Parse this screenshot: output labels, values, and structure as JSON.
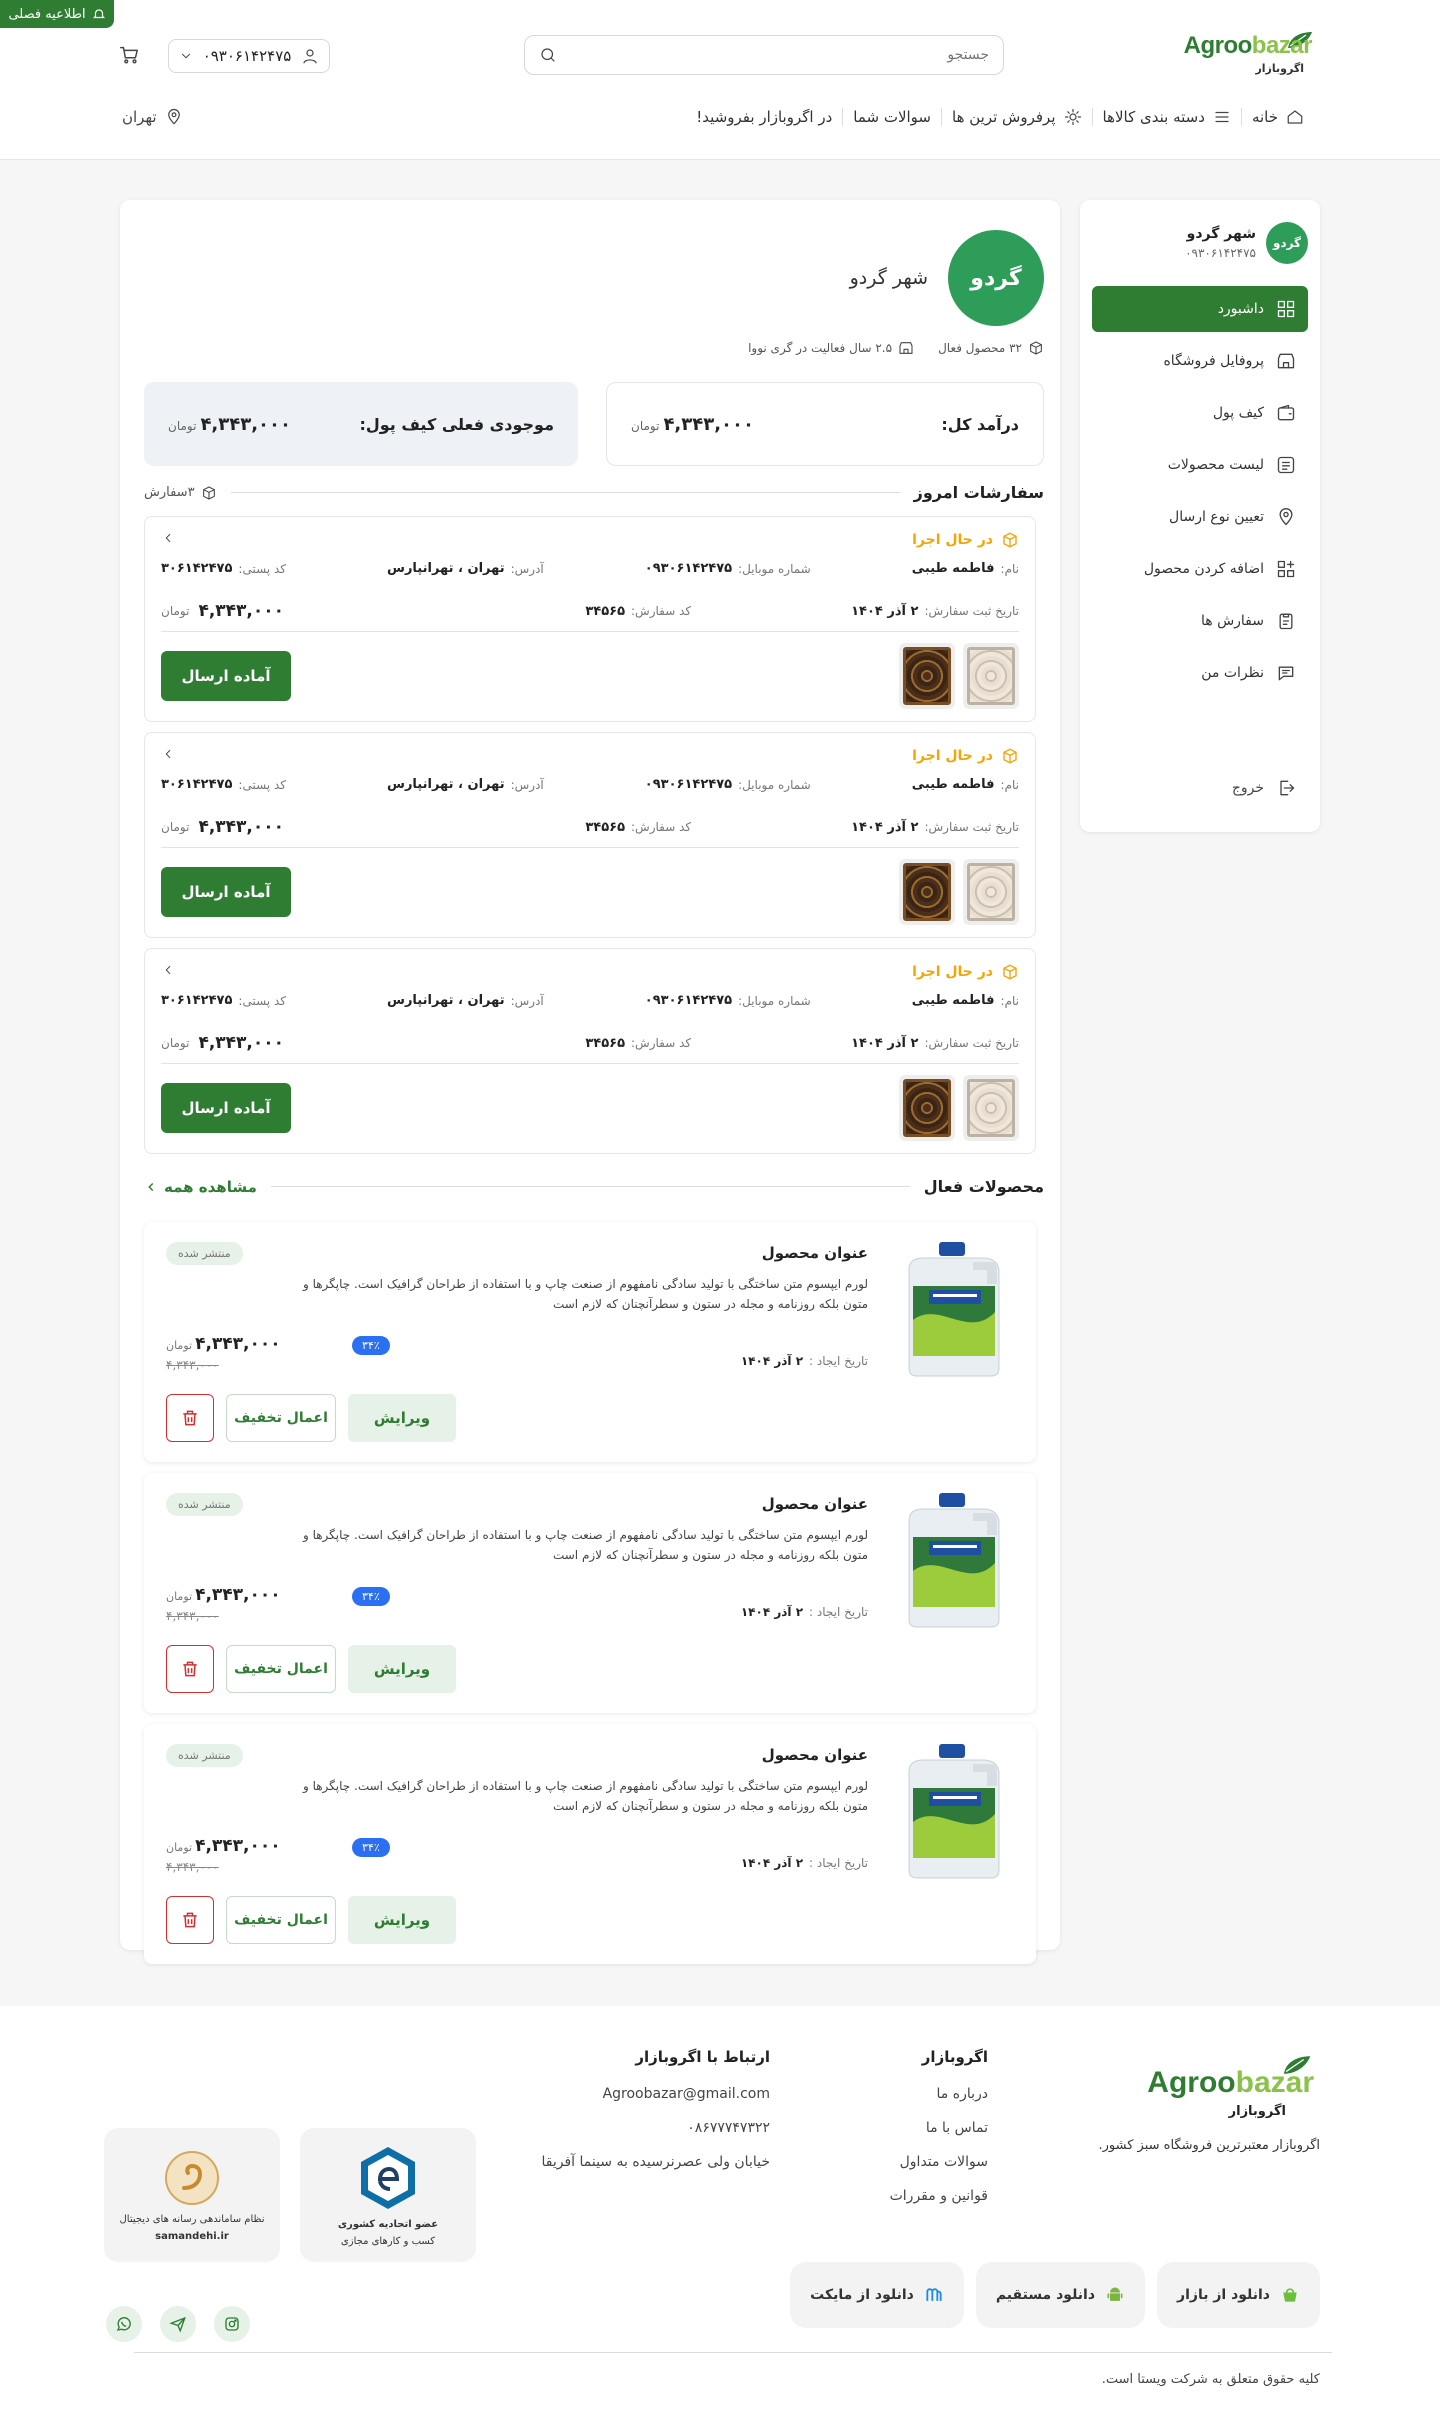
{
  "notice": "اطلاعیه فصلی",
  "logo": {
    "en_a": "Agroo",
    "en_b": "bazar",
    "fa": "اگروبازار"
  },
  "search": {
    "placeholder": "جستجو"
  },
  "user": {
    "phone": "۰۹۳۰۶۱۴۲۴۷۵"
  },
  "nav": [
    {
      "label": "خانه",
      "icon": "home-icon"
    },
    {
      "label": "دسته بندی کالاها",
      "icon": "menu-icon"
    },
    {
      "label": "پرفروش ترین ها",
      "icon": "sun-icon"
    },
    {
      "label": "سوالات شما",
      "icon": ""
    },
    {
      "label": "در اگروبازار بفروشید!",
      "icon": ""
    }
  ],
  "city": "تهران",
  "sidebar": {
    "shop_name": "شهر گردو",
    "shop_phone": "۰۹۳۰۶۱۴۲۴۷۵",
    "items": [
      {
        "label": "داشبورد",
        "icon": "dashboard-icon",
        "active": true
      },
      {
        "label": "پروفایل فروشگاه",
        "icon": "store-icon"
      },
      {
        "label": "کیف پول",
        "icon": "wallet-icon"
      },
      {
        "label": "لیست محصولات",
        "icon": "list-icon"
      },
      {
        "label": "تعیین نوع ارسال",
        "icon": "location-icon"
      },
      {
        "label": "اضافه کردن محصول",
        "icon": "add-icon"
      },
      {
        "label": "سفارش ها",
        "icon": "orders-icon"
      },
      {
        "label": "نظرات من",
        "icon": "comments-icon"
      }
    ],
    "logout": "خروج"
  },
  "shop": {
    "name": "شهر گردو",
    "logo_text": "گردو",
    "active_products": "۳۲ محصول فعال",
    "years": "۲.۵ سال فعالیت در گری نووا"
  },
  "stats": {
    "income_label": "درآمد کل:",
    "income_value": "۴,۳۴۳,۰۰۰",
    "wallet_label": "موجودی فعلی کیف پول:",
    "wallet_value": "۴,۳۴۳,۰۰۰",
    "currency": "تومان"
  },
  "orders_section": {
    "title": "سفارشات امروز",
    "count": "۳سفارش"
  },
  "orders": [
    {
      "status": "در حال اجرا",
      "name_k": "نام:",
      "name": "فاطمه طیبی",
      "mobile_k": "شماره موبایل:",
      "mobile": "۰۹۳۰۶۱۴۲۴۷۵",
      "address_k": "آدرس:",
      "address": "تهران ، تهرانپارس",
      "postal_k": "کد پستی:",
      "postal": "۳۰۶۱۴۲۴۷۵",
      "date_k": "تاریخ ثبت سفارش:",
      "date": "۲ آذر ۱۴۰۴",
      "code_k": "کد سفارش:",
      "code": "۳۴۵۶۵",
      "price": "۴,۳۴۳,۰۰۰",
      "currency": "تومان",
      "button": "آماده ارسال"
    },
    {
      "status": "در حال اجرا",
      "name_k": "نام:",
      "name": "فاطمه طیبی",
      "mobile_k": "شماره موبایل:",
      "mobile": "۰۹۳۰۶۱۴۲۴۷۵",
      "address_k": "آدرس:",
      "address": "تهران ، تهرانپارس",
      "postal_k": "کد پستی:",
      "postal": "۳۰۶۱۴۲۴۷۵",
      "date_k": "تاریخ ثبت سفارش:",
      "date": "۲ آذر ۱۴۰۴",
      "code_k": "کد سفارش:",
      "code": "۳۴۵۶۵",
      "price": "۴,۳۴۳,۰۰۰",
      "currency": "تومان",
      "button": "آماده ارسال"
    },
    {
      "status": "در حال اجرا",
      "name_k": "نام:",
      "name": "فاطمه طیبی",
      "mobile_k": "شماره موبایل:",
      "mobile": "۰۹۳۰۶۱۴۲۴۷۵",
      "address_k": "آدرس:",
      "address": "تهران ، تهرانپارس",
      "postal_k": "کد پستی:",
      "postal": "۳۰۶۱۴۲۴۷۵",
      "date_k": "تاریخ ثبت سفارش:",
      "date": "۲ آذر ۱۴۰۴",
      "code_k": "کد سفارش:",
      "code": "۳۴۵۶۵",
      "price": "۴,۳۴۳,۰۰۰",
      "currency": "تومان",
      "button": "آماده ارسال"
    }
  ],
  "products_section": {
    "title": "محصولات فعال",
    "see_all": "مشاهده همه"
  },
  "products": [
    {
      "title": "عنوان محصول",
      "desc": "لورم ایپسوم متن ساختگی با تولید سادگی نامفهوم از صنعت چاپ و با استفاده از طراحان گرافیک است. چاپگرها و متون بلکه روزنامه و مجله در ستون و سطرآنچنان که لازم است",
      "status": "منتشر شده",
      "date_k": "تاریخ ایجاد :",
      "date": "۲ آذر ۱۴۰۴",
      "price": "۴,۳۴۳,۰۰۰",
      "old_price": "۴,۳۴۳,۰۰۰",
      "currency": "تومان",
      "discount": "۳۴٪",
      "edit": "ویرایش",
      "apply_discount": "اعمال تخفیف"
    },
    {
      "title": "عنوان محصول",
      "desc": "لورم ایپسوم متن ساختگی با تولید سادگی نامفهوم از صنعت چاپ و با استفاده از طراحان گرافیک است. چاپگرها و متون بلکه روزنامه و مجله در ستون و سطرآنچنان که لازم است",
      "status": "منتشر شده",
      "date_k": "تاریخ ایجاد :",
      "date": "۲ آذر ۱۴۰۴",
      "price": "۴,۳۴۳,۰۰۰",
      "old_price": "۴,۳۴۳,۰۰۰",
      "currency": "تومان",
      "discount": "۳۴٪",
      "edit": "ویرایش",
      "apply_discount": "اعمال تخفیف"
    },
    {
      "title": "عنوان محصول",
      "desc": "لورم ایپسوم متن ساختگی با تولید سادگی نامفهوم از صنعت چاپ و با استفاده از طراحان گرافیک است. چاپگرها و متون بلکه روزنامه و مجله در ستون و سطرآنچنان که لازم است",
      "status": "منتشر شده",
      "date_k": "تاریخ ایجاد :",
      "date": "۲ آذر ۱۴۰۴",
      "price": "۴,۳۴۳,۰۰۰",
      "old_price": "۴,۳۴۳,۰۰۰",
      "currency": "تومان",
      "discount": "۳۴٪",
      "edit": "ویرایش",
      "apply_discount": "اعمال تخفیف"
    }
  ],
  "footer": {
    "slogan": "اگروبازار معتبرترین فروشگاه سبز کشور.",
    "col1_title": "اگروبازار",
    "col1_links": [
      "درباره ما",
      "تماس با ما",
      "سوالات متداول",
      "قوانین و مقررات"
    ],
    "col2_title": "ارتباط با اگروبازار",
    "email": "Agroobazar@gmail.com",
    "phone": "۰۸۶۷۷۷۴۷۳۲۲",
    "address": "خیابان ولی عصرنرسیده به سینما آفریقا",
    "badge1": [
      "عضو اتحادیه کشوری",
      "کسب و کارهای مجازی"
    ],
    "badge2": [
      "نظام ساماندهی رسانه های دیجیتال",
      "samandehi.ir"
    ],
    "apps": [
      {
        "label": "دانلود از بازار",
        "icon": "bazaar-icon"
      },
      {
        "label": "دانلود مستقیم",
        "icon": "android-icon"
      },
      {
        "label": "دانلود از مایکت",
        "icon": "myket-icon"
      }
    ],
    "copyright": "کلیه حقوق متعلق به شرکت ویستا است."
  },
  "colors": {
    "brand": "#2e7d32",
    "status": "#f5a500",
    "discount": "#2b6ff2",
    "danger": "#d32f2f"
  }
}
